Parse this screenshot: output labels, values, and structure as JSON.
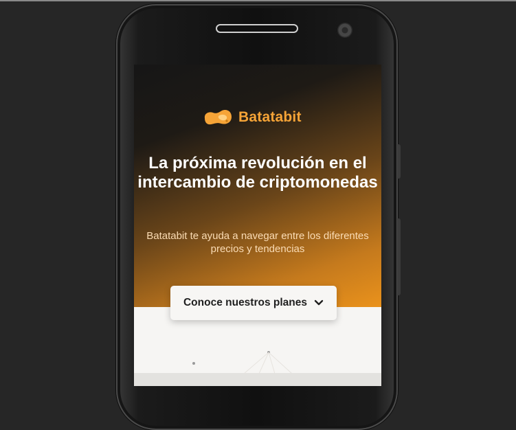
{
  "brand": {
    "name": "Batatabit",
    "accent": "#f6a437"
  },
  "hero": {
    "headline": "La próxima revolución en el intercambio de criptomonedas",
    "subtitle": "Batatabit te ayuda a navegar entre los diferentes precios y tendencias",
    "cta_label": "Conoce nuestros planes",
    "cta_icon": "chevron-down-icon"
  },
  "colors": {
    "background": "#262626",
    "hero_dark": "#161616",
    "hero_orange": "#ea921c",
    "page_light": "#f6f5f3"
  }
}
